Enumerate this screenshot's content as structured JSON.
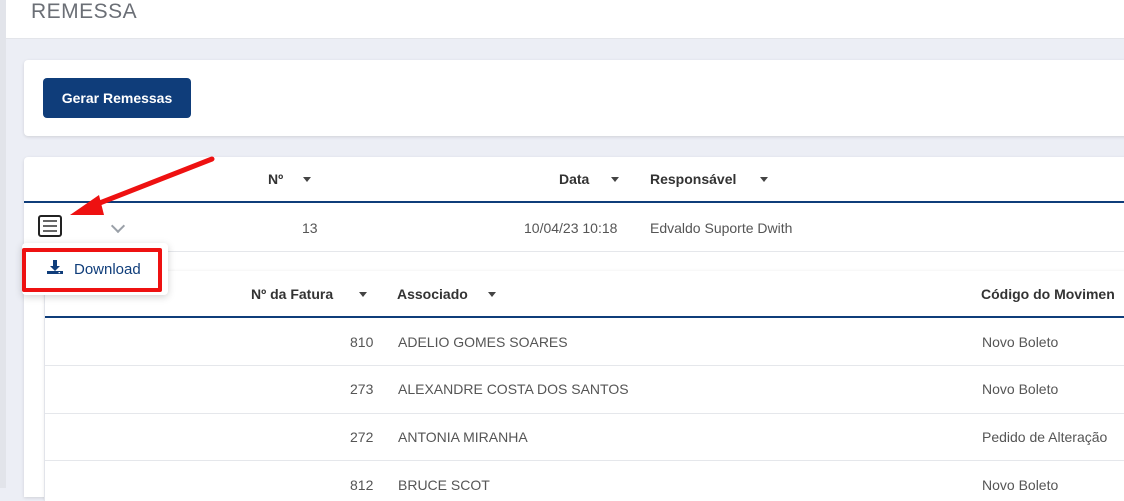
{
  "page": {
    "title": "REMESSA"
  },
  "toolbar": {
    "generate_label": "Gerar Remessas"
  },
  "main_table": {
    "headers": {
      "number": "Nº",
      "date": "Data",
      "responsible": "Responsável"
    },
    "row": {
      "number": "13",
      "date": "10/04/23 10:18",
      "responsible": "Edvaldo Suporte Dwith"
    }
  },
  "context_menu": {
    "download_label": "Download"
  },
  "sub_table": {
    "headers": {
      "invoice": "Nº da Fatura",
      "associate": "Associado",
      "movement_code": "Código do Movimen"
    },
    "rows": [
      {
        "invoice": "810",
        "associate": "ADELIO GOMES SOARES",
        "movement": "Novo Boleto"
      },
      {
        "invoice": "273",
        "associate": "ALEXANDRE COSTA DOS SANTOS",
        "movement": "Novo Boleto"
      },
      {
        "invoice": "272",
        "associate": "ANTONIA MIRANHA",
        "movement": "Pedido de Alteração"
      },
      {
        "invoice": "812",
        "associate": "BRUCE SCOT",
        "movement": "Novo Boleto"
      }
    ]
  },
  "colors": {
    "primary": "#0f3d7a",
    "highlight": "#ee1111"
  }
}
